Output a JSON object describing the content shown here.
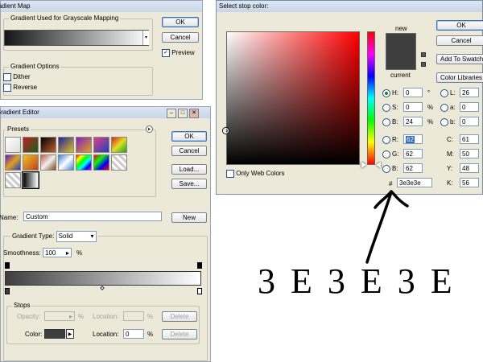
{
  "gradient_map": {
    "title": "Gradient Map",
    "section_title": "Gradient Used for Grayscale Mapping",
    "ok": "OK",
    "cancel": "Cancel",
    "preview_label": "Preview",
    "options_title": "Gradient Options",
    "dither_label": "Dither",
    "reverse_label": "Reverse"
  },
  "gradient_editor": {
    "title": "Gradient Editor",
    "presets_label": "Presets",
    "ok": "OK",
    "cancel": "Cancel",
    "load": "Load...",
    "save": "Save...",
    "name_label": "Name:",
    "name_value": "Custom",
    "new_button": "New",
    "gradient_type_label": "Gradient Type:",
    "gradient_type_value": "Solid",
    "smoothness_label": "Smoothness:",
    "smoothness_value": "100",
    "percent": "%",
    "stops_title": "Stops",
    "opacity_label": "Opacity:",
    "location_label": "Location:",
    "color_label": "Color:",
    "color_location_value": "0",
    "delete": "Delete"
  },
  "color_picker": {
    "title": "Select stop color:",
    "new_label": "new",
    "current_label": "current",
    "ok": "OK",
    "cancel": "Cancel",
    "add_to_swatches": "Add To Swatches",
    "color_libraries": "Color Libraries",
    "only_web_colors": "Only Web Colors",
    "hash": "#",
    "hex_value": "3e3e3e",
    "color": "#3e3e3e",
    "fields": {
      "h": {
        "label": "H:",
        "value": "0",
        "unit": "°"
      },
      "s": {
        "label": "S:",
        "value": "0",
        "unit": "%"
      },
      "b_hsb": {
        "label": "B:",
        "value": "24",
        "unit": "%"
      },
      "r": {
        "label": "R:",
        "value": "62"
      },
      "g": {
        "label": "G:",
        "value": "62"
      },
      "b_rgb": {
        "label": "B:",
        "value": "62"
      },
      "l": {
        "label": "L:",
        "value": "26"
      },
      "a": {
        "label": "a:",
        "value": "0"
      },
      "b_lab": {
        "label": "b:",
        "value": "0"
      },
      "c": {
        "label": "C:",
        "value": "61",
        "unit": "%"
      },
      "m": {
        "label": "M:",
        "value": "50",
        "unit": "%"
      },
      "y": {
        "label": "Y:",
        "value": "48",
        "unit": "%"
      },
      "k": {
        "label": "K:",
        "value": "56",
        "unit": "%"
      }
    }
  },
  "annotation": {
    "text": "3 E 3 E 3 E"
  }
}
